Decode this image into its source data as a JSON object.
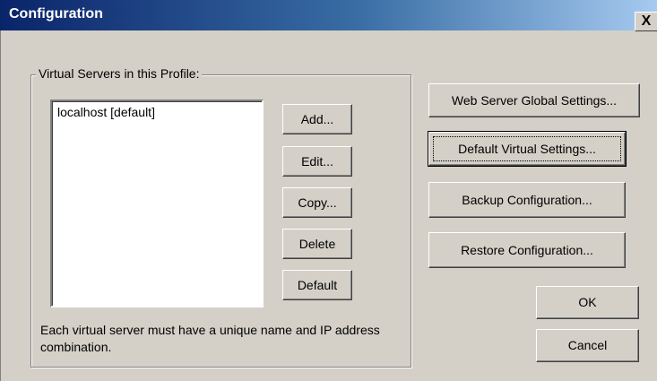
{
  "window": {
    "title": "Configuration",
    "close_glyph": "X"
  },
  "group": {
    "label": "Virtual Servers in this Profile:"
  },
  "list": {
    "items": [
      "localhost [default]"
    ]
  },
  "buttons": {
    "add": "Add...",
    "edit": "Edit...",
    "copy": "Copy...",
    "delete": "Delete",
    "default": "Default",
    "web_server_global": "Web Server Global Settings...",
    "default_virtual": "Default Virtual Settings...",
    "backup": "Backup Configuration...",
    "restore": "Restore Configuration...",
    "ok": "OK",
    "cancel": "Cancel"
  },
  "help_text": "Each virtual server must have a unique name and IP address combination."
}
